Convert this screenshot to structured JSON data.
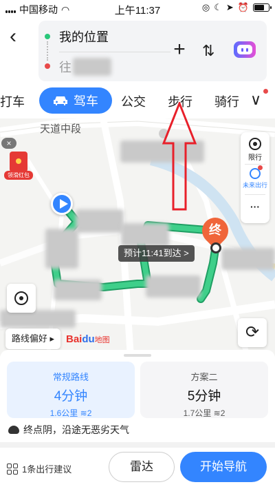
{
  "status_bar": {
    "carrier": "中国移动",
    "time": "上午11:37"
  },
  "route": {
    "origin": "我的位置",
    "destination": "往"
  },
  "tabs": [
    {
      "label": "打车"
    },
    {
      "label": "驾车",
      "active": true
    },
    {
      "label": "公交"
    },
    {
      "label": "步行"
    },
    {
      "label": "骑行"
    }
  ],
  "map": {
    "road_label": "天道中段",
    "close_label": "×",
    "hongbao_label": "领滑红包",
    "side_panel": {
      "limit_label": "限行",
      "future_label": "未来出行",
      "more_label": "···"
    },
    "end_marker_label": "终",
    "eta": "预计11:41到达 >",
    "route_pref": "路线偏好 ▸",
    "logo": {
      "bai": "Bai",
      "du": "du",
      "suffix": "地图"
    }
  },
  "plans": [
    {
      "name": "常规路线",
      "time": "4分钟",
      "distance": "1.6公里",
      "lights": "2"
    },
    {
      "name": "方案二",
      "time": "5分钟",
      "distance": "1.7公里",
      "lights": "2"
    }
  ],
  "weather": "终点阴，沿途无恶劣天气",
  "bottom_bar": {
    "advice": "1条出行建议",
    "radar": "雷达",
    "start": "开始导航"
  },
  "colors": {
    "accent": "#3385ff",
    "route": "#2db87a",
    "annotation": "#e8202a"
  }
}
